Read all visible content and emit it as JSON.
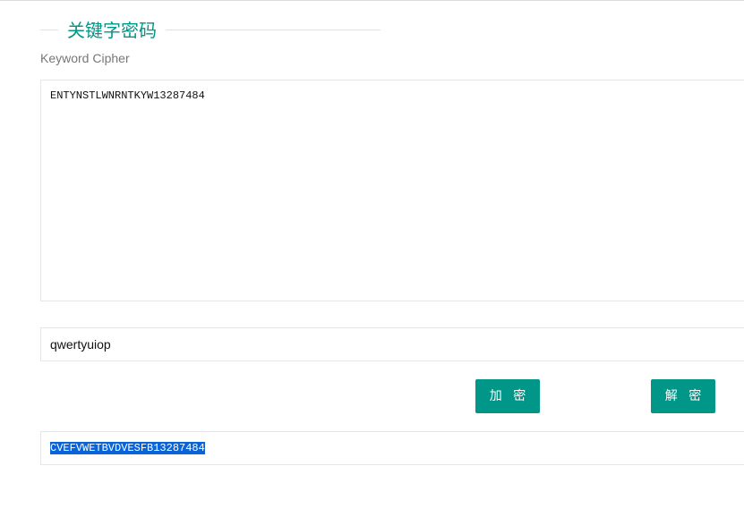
{
  "page": {
    "title": "关键字密码",
    "subtitle": "Keyword Cipher"
  },
  "input": {
    "text": "ENTYNSTLWNRNTKYW13287484"
  },
  "key": {
    "value": "qwertyuiop"
  },
  "buttons": {
    "encrypt_label": "加 密",
    "decrypt_label": "解 密"
  },
  "output": {
    "text": "CVEFVWETBVDVESFB13287484",
    "selected": true
  },
  "colors": {
    "accent": "#009688",
    "selection": "#0a64d8",
    "border": "#e6e6e6",
    "subtitle": "#777777"
  }
}
